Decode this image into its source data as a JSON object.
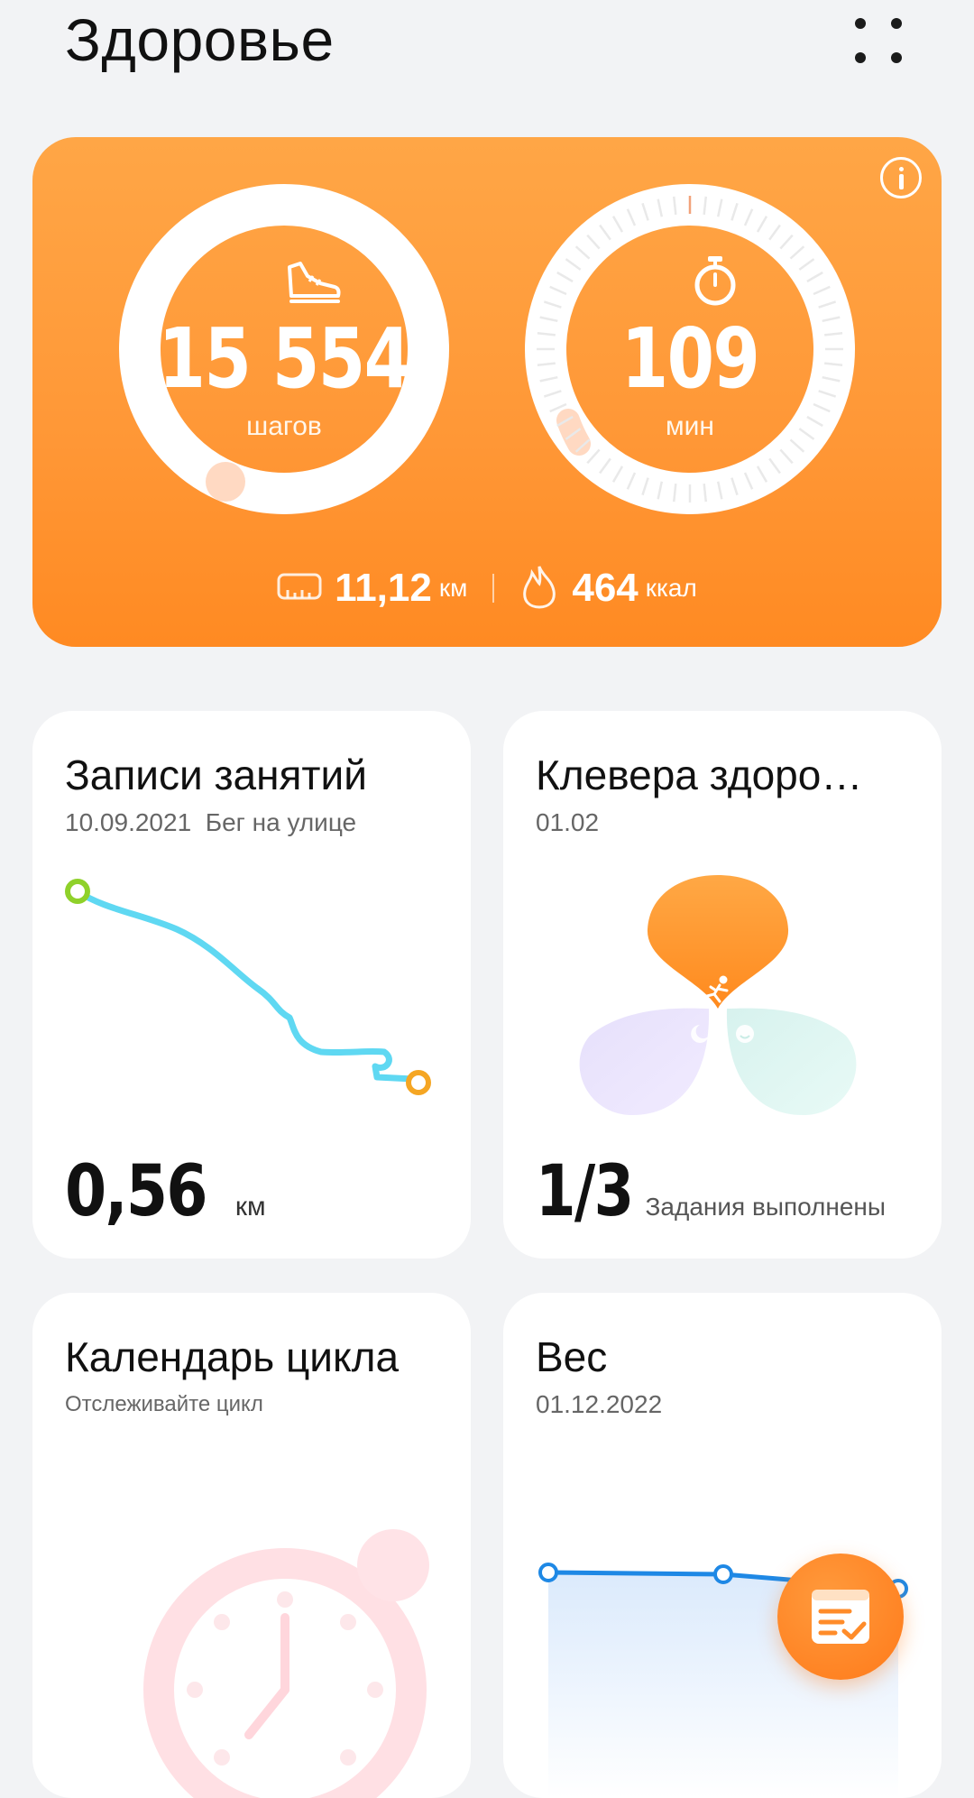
{
  "header": {
    "title": "Здоровье"
  },
  "activity": {
    "steps": {
      "value": "15 554",
      "label": "шагов"
    },
    "minutes": {
      "value": "109",
      "label": "мин"
    },
    "distance": {
      "value": "11,12",
      "unit": "км"
    },
    "calories": {
      "value": "464",
      "unit": "ккал"
    }
  },
  "cards": {
    "workouts": {
      "title": "Записи занятий",
      "date": "10.09.2021",
      "type": "Бег на улице",
      "value": "0,56",
      "unit": "км"
    },
    "clover": {
      "title": "Клевера здоро…",
      "date": "01.02",
      "value": "1/3",
      "label": "Задания выполнены"
    },
    "cycle": {
      "title": "Календарь цикла",
      "subtitle": "Отслеживайте цикл"
    },
    "weight": {
      "title": "Вес",
      "date": "01.12.2022"
    }
  },
  "colors": {
    "accent": "#ff9a36",
    "route": "#5fd8f2",
    "route_start": "#8fd12a",
    "route_end": "#f5a623",
    "weight_line": "#1e88e5"
  },
  "icons": {
    "menu": "dots-grid-icon",
    "info": "info-icon",
    "steps": "shoe-icon",
    "minutes": "stopwatch-icon",
    "distance": "ruler-icon",
    "calories": "flame-icon",
    "fab": "checklist-icon"
  }
}
